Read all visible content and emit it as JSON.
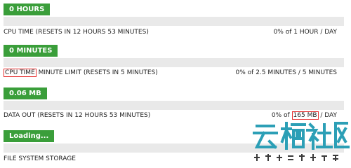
{
  "sections": [
    {
      "badge": "0 HOURS",
      "label": "CPU TIME  (RESETS IN 12 HOURS 53 MINUTES)",
      "usage": "0% of 1 HOUR / DAY",
      "fill_fraction": 0
    },
    {
      "badge": "0 MINUTES",
      "label_highlight": "CPU TIME",
      "label_rest": " MINUTE LIMIT  (RESETS IN 5 MINUTES)",
      "usage": "0% of 2.5 MINUTES / 5 MINUTES",
      "fill_fraction": 0
    },
    {
      "badge": "0.06 MB",
      "label": "DATA OUT  (RESETS IN 12 HOURS 53 MINUTES)",
      "usage_prefix": "0% of ",
      "usage_highlight": "165 MB",
      "usage_suffix": " / DAY",
      "fill_fraction": 0
    },
    {
      "badge": "Loading...",
      "label": "FILE SYSTEM STORAGE"
    }
  ],
  "watermark": {
    "text": "云栖社区",
    "subtitle": "开发者的云中江湖"
  },
  "colors": {
    "badge": "#3a9e3a",
    "bar_track": "#e9e9e9",
    "highlight_border": "#e53030"
  }
}
